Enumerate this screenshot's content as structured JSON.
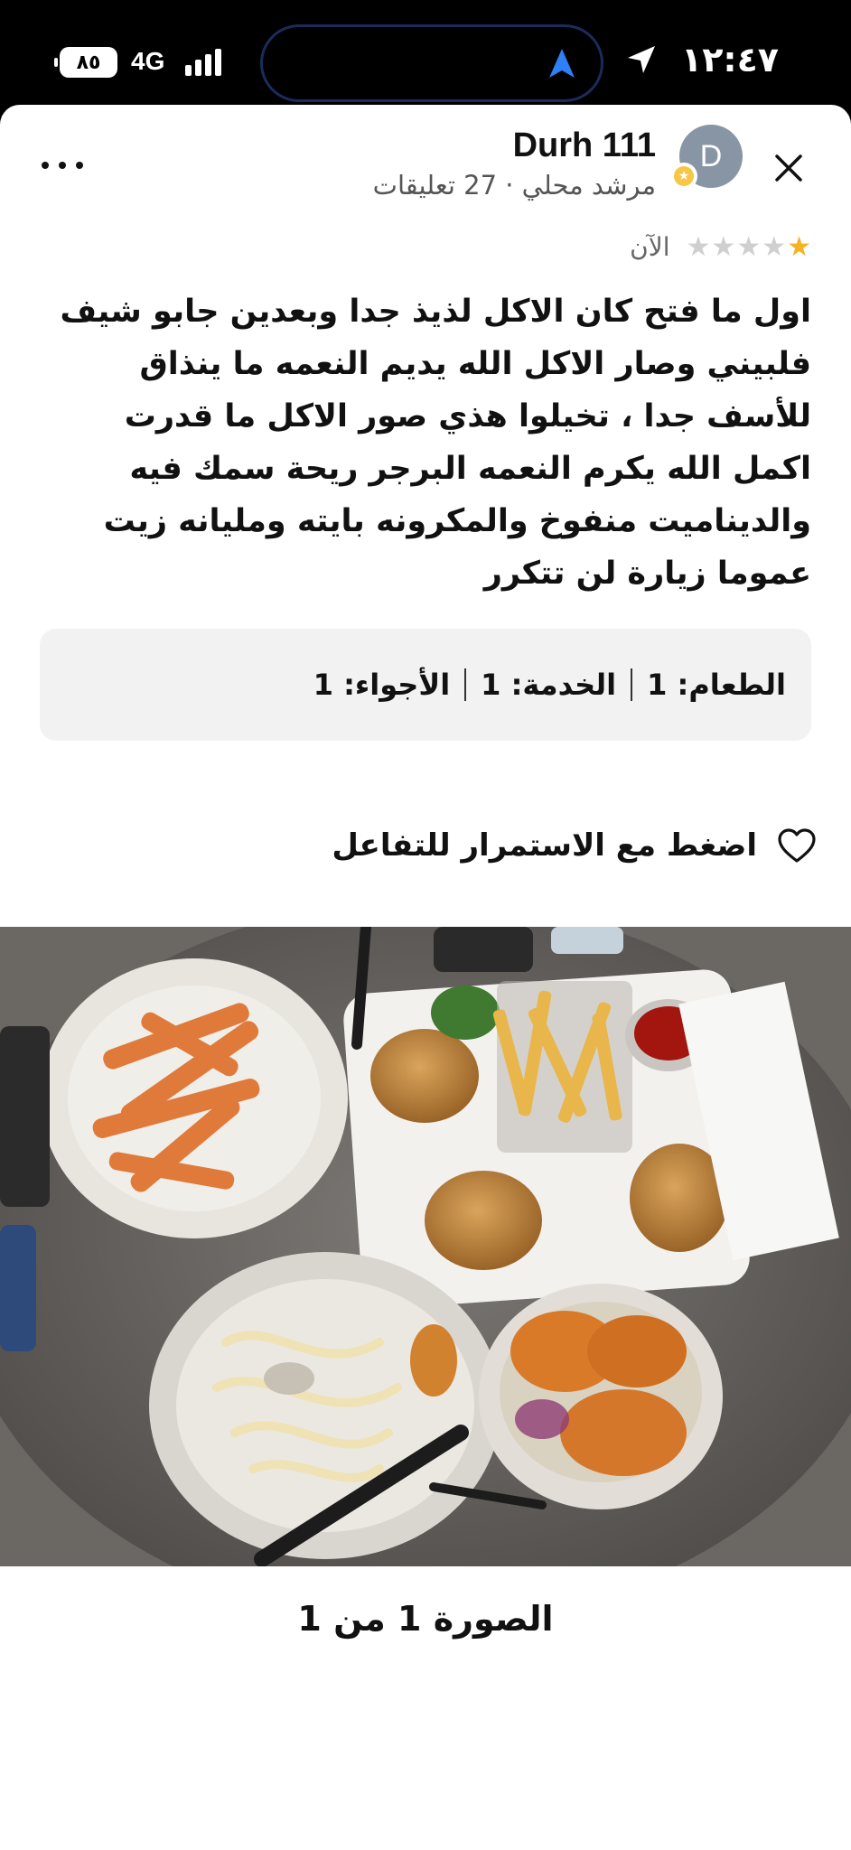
{
  "status_bar": {
    "battery": "٨٥",
    "network": "4G",
    "time": "١٢:٤٧"
  },
  "header": {
    "user_name": "Durh 111",
    "avatar_initial": "D",
    "user_meta": "مرشد محلي · 27 تعليقات"
  },
  "review": {
    "stars": 1,
    "max_stars": 5,
    "time_ago": "الآن",
    "text": "اول ما فتح كان الاكل لذيذ جدا وبعدين جابو شيف فلبيني وصار الاكل الله يديم النعمه ما ينذاق للأسف جدا ، تخيلوا هذي صور الاكل ما قدرت اكمل الله يكرم النعمه البرجر ريحة سمك فيه والديناميت منفوخ والمكرونه بايته ومليانه زيت عموما زيارة لن تتكرر"
  },
  "ratings": {
    "food": "الطعام: 1",
    "service": "الخدمة: 1",
    "atmosphere": "الأجواء: 1"
  },
  "like": {
    "label": "اضغط مع الاستمرار للتفاعل",
    "icon": "heart-outline-icon"
  },
  "photo": {
    "counter": "الصورة 1 من 1"
  },
  "colors": {
    "star_on": "#f5b223",
    "star_off": "#cfcfcf",
    "avatar_bg": "#8895a4",
    "ratings_bg": "#f2f2f2"
  }
}
